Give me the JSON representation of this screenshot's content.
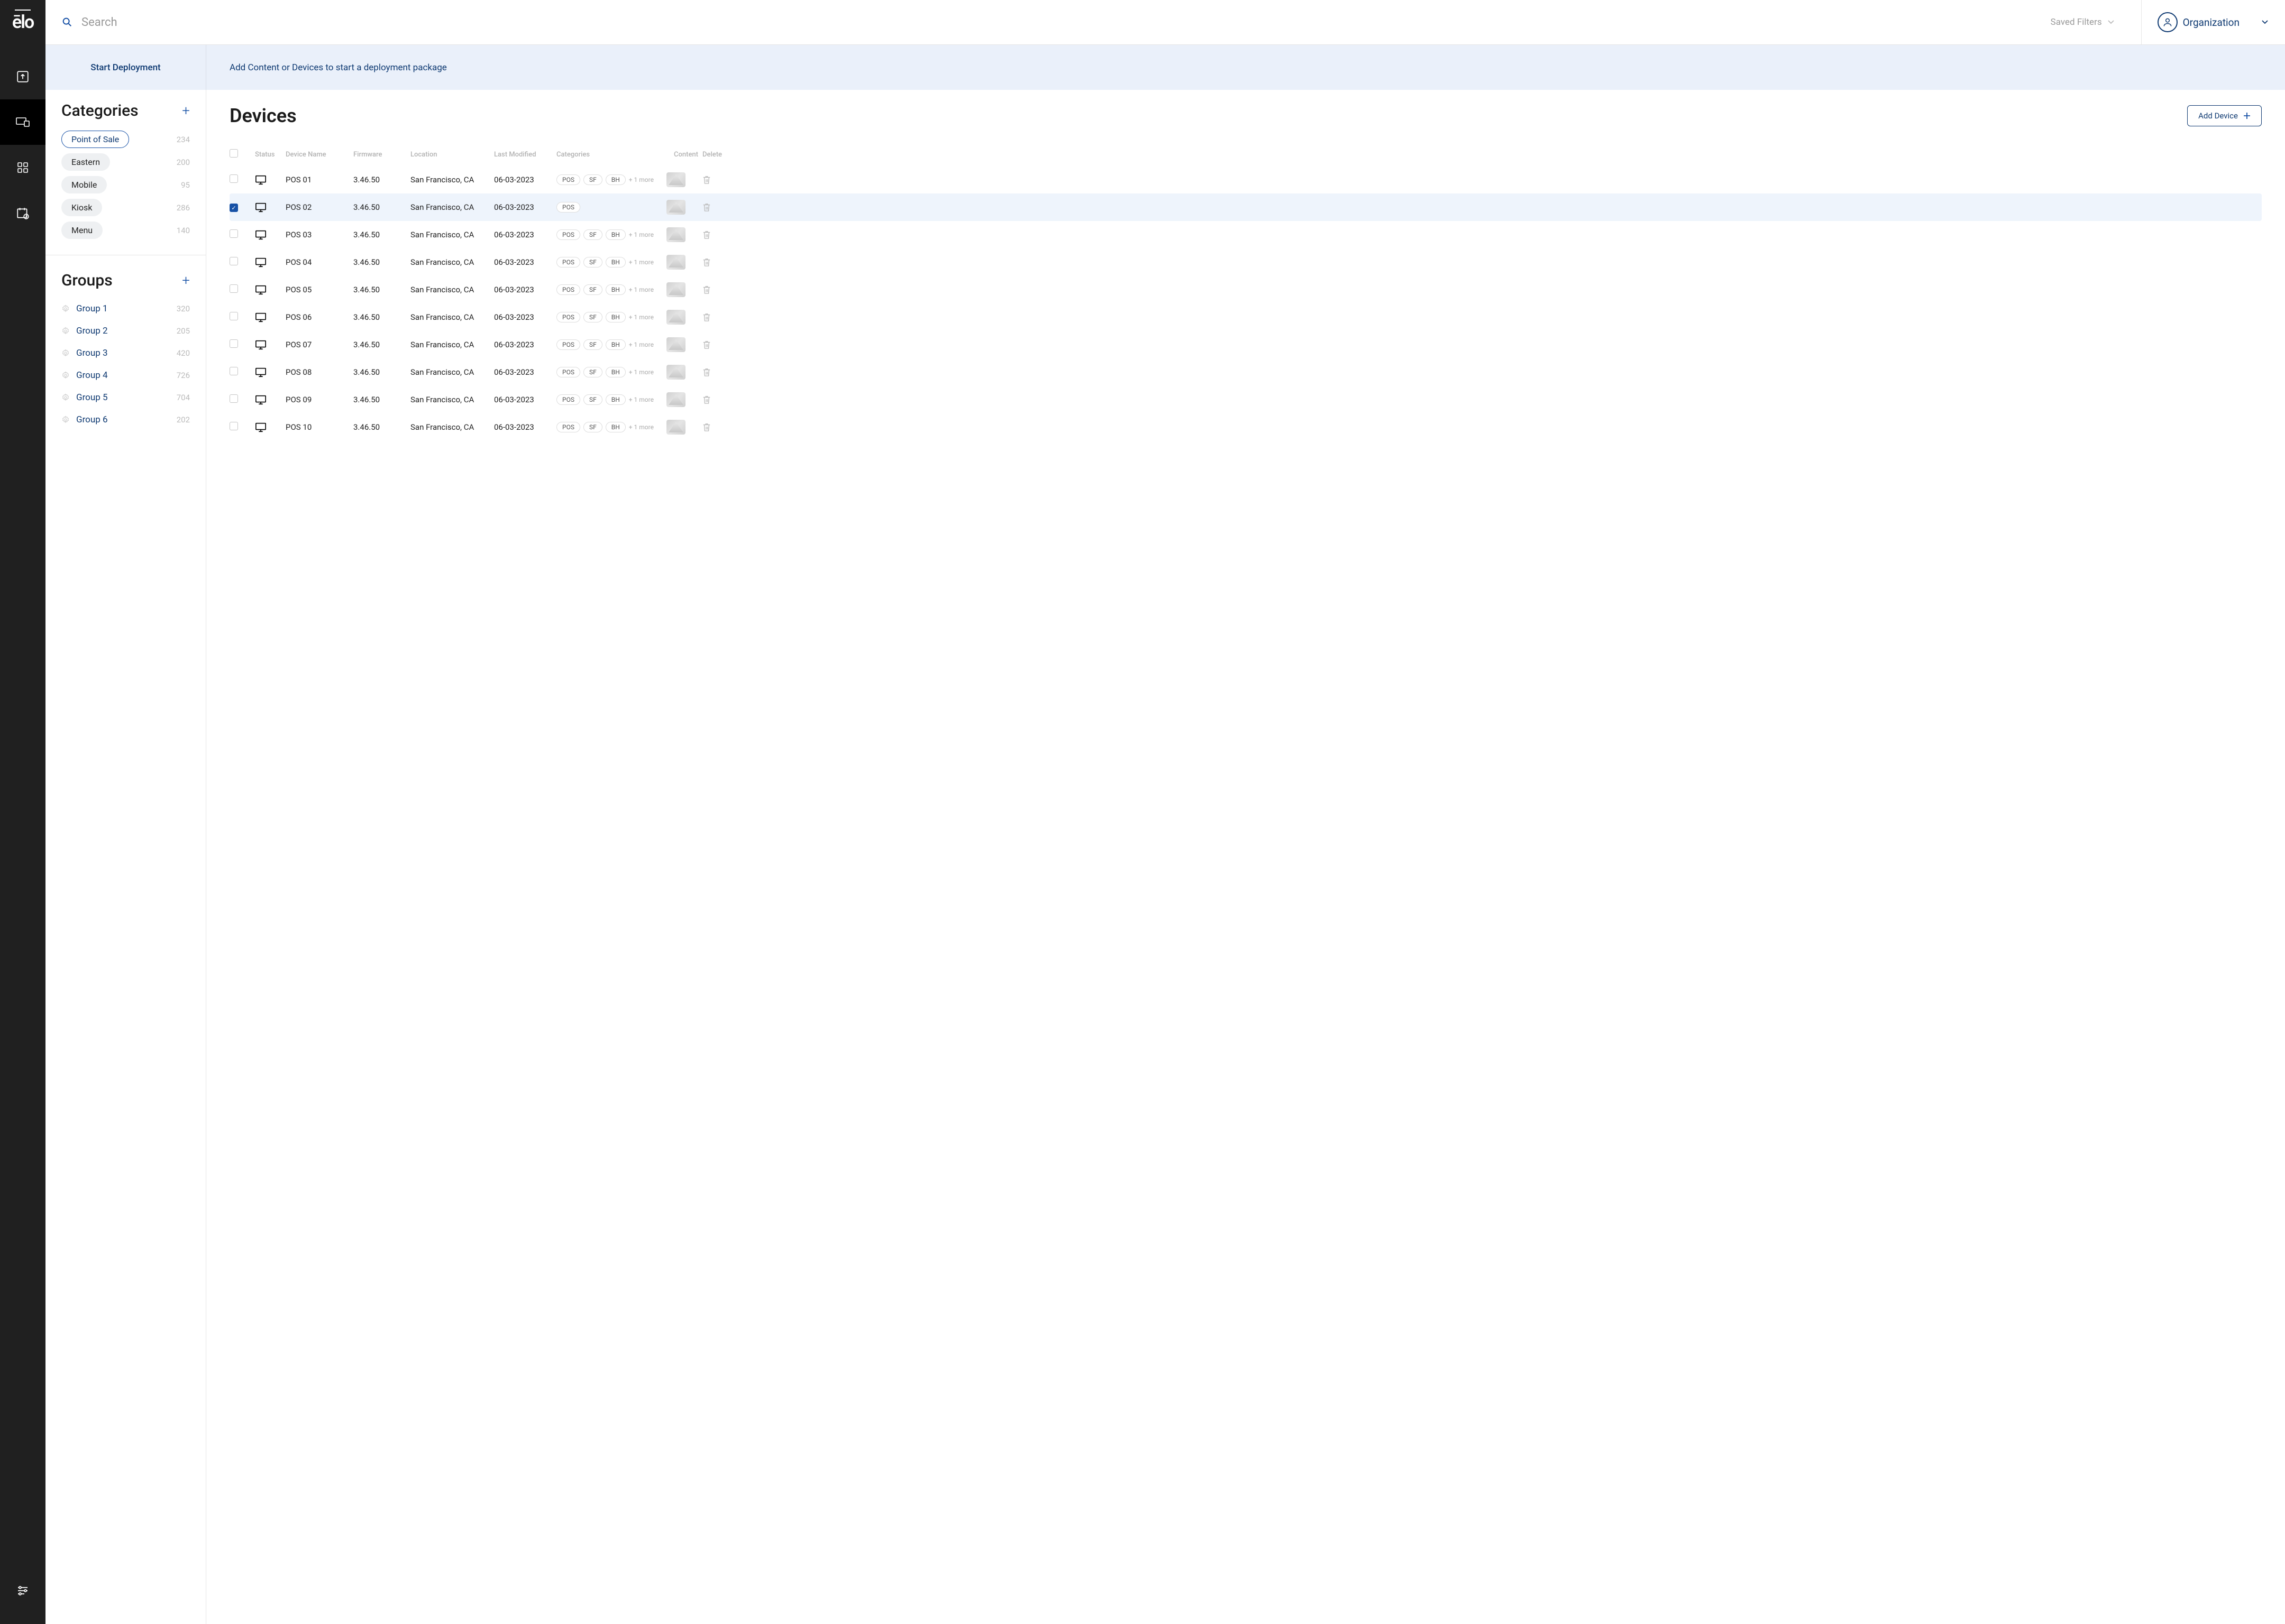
{
  "brand": "ēlo",
  "search": {
    "placeholder": "Search"
  },
  "saved_filters_label": "Saved Filters",
  "org_label": "Organization",
  "banner": {
    "start": "Start Deployment",
    "msg": "Add Content or Devices to start a deployment package"
  },
  "categories": {
    "title": "Categories",
    "items": [
      {
        "label": "Point of Sale",
        "count": "234",
        "selected": true
      },
      {
        "label": "Eastern",
        "count": "200",
        "selected": false
      },
      {
        "label": "Mobile",
        "count": "95",
        "selected": false
      },
      {
        "label": "Kiosk",
        "count": "286",
        "selected": false
      },
      {
        "label": "Menu",
        "count": "140",
        "selected": false
      }
    ]
  },
  "groups": {
    "title": "Groups",
    "items": [
      {
        "label": "Group 1",
        "count": "320"
      },
      {
        "label": "Group 2",
        "count": "205"
      },
      {
        "label": "Group 3",
        "count": "420"
      },
      {
        "label": "Group 4",
        "count": "726"
      },
      {
        "label": "Group 5",
        "count": "704"
      },
      {
        "label": "Group 6",
        "count": "202"
      }
    ]
  },
  "page": {
    "title": "Devices",
    "add_label": "Add Device"
  },
  "columns": {
    "status": "Status",
    "name": "Device Name",
    "fw": "Firmware",
    "loc": "Location",
    "mod": "Last Modified",
    "cat": "Categories",
    "content": "Content",
    "del": "Delete"
  },
  "more_suffix": "+ 1 more",
  "rows": [
    {
      "sel": false,
      "name": "POS 01",
      "fw": "3.46.50",
      "loc": "San Francisco, CA",
      "mod": "06-03-2023",
      "tags": [
        "POS",
        "SF",
        "BH"
      ],
      "more": true
    },
    {
      "sel": true,
      "name": "POS 02",
      "fw": "3.46.50",
      "loc": "San Francisco, CA",
      "mod": "06-03-2023",
      "tags": [
        "POS"
      ],
      "more": false
    },
    {
      "sel": false,
      "name": "POS 03",
      "fw": "3.46.50",
      "loc": "San Francisco, CA",
      "mod": "06-03-2023",
      "tags": [
        "POS",
        "SF",
        "BH"
      ],
      "more": true
    },
    {
      "sel": false,
      "name": "POS 04",
      "fw": "3.46.50",
      "loc": "San Francisco, CA",
      "mod": "06-03-2023",
      "tags": [
        "POS",
        "SF",
        "BH"
      ],
      "more": true
    },
    {
      "sel": false,
      "name": "POS 05",
      "fw": "3.46.50",
      "loc": "San Francisco, CA",
      "mod": "06-03-2023",
      "tags": [
        "POS",
        "SF",
        "BH"
      ],
      "more": true
    },
    {
      "sel": false,
      "name": "POS 06",
      "fw": "3.46.50",
      "loc": "San Francisco, CA",
      "mod": "06-03-2023",
      "tags": [
        "POS",
        "SF",
        "BH"
      ],
      "more": true
    },
    {
      "sel": false,
      "name": "POS 07",
      "fw": "3.46.50",
      "loc": "San Francisco, CA",
      "mod": "06-03-2023",
      "tags": [
        "POS",
        "SF",
        "BH"
      ],
      "more": true
    },
    {
      "sel": false,
      "name": "POS 08",
      "fw": "3.46.50",
      "loc": "San Francisco, CA",
      "mod": "06-03-2023",
      "tags": [
        "POS",
        "SF",
        "BH"
      ],
      "more": true
    },
    {
      "sel": false,
      "name": "POS 09",
      "fw": "3.46.50",
      "loc": "San Francisco, CA",
      "mod": "06-03-2023",
      "tags": [
        "POS",
        "SF",
        "BH"
      ],
      "more": true
    },
    {
      "sel": false,
      "name": "POS 10",
      "fw": "3.46.50",
      "loc": "San Francisco, CA",
      "mod": "06-03-2023",
      "tags": [
        "POS",
        "SF",
        "BH"
      ],
      "more": true
    }
  ]
}
